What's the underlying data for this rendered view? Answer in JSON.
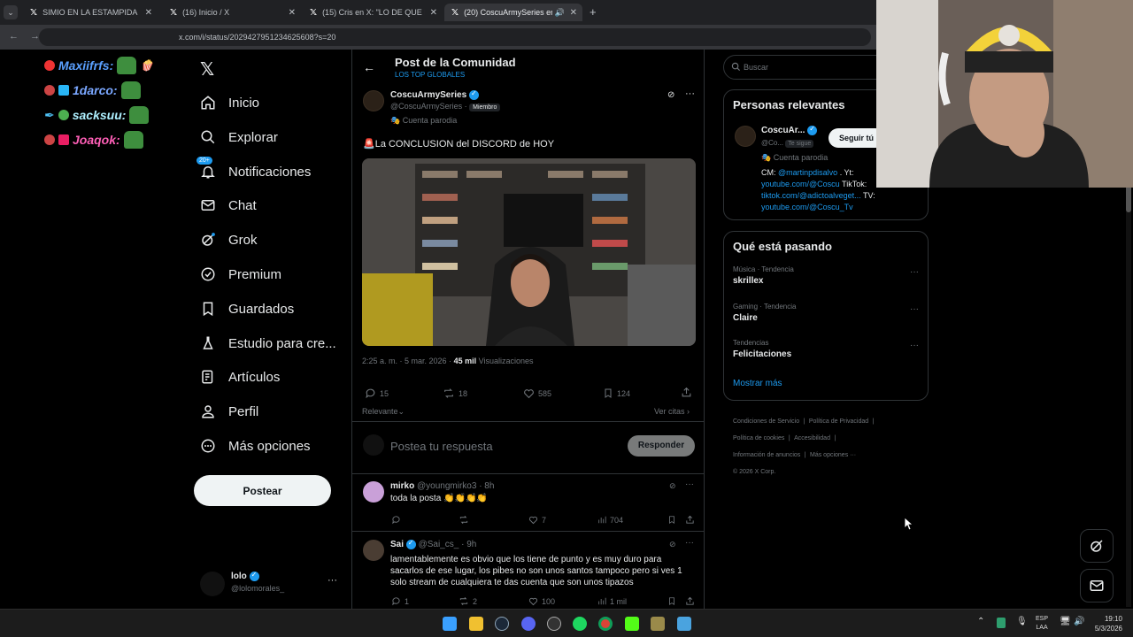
{
  "browser": {
    "tabs": [
      {
        "title": "SIMIO EN LA ESTAMPIDA"
      },
      {
        "title": "(16) Inicio / X"
      },
      {
        "title": "(15) Cris en X: \"LO DE QUE LOU"
      },
      {
        "title": "(20) CoscuArmySeries en X"
      }
    ],
    "new_tab": "+",
    "url": "x.com/i/status/2029427951234625608?s=20"
  },
  "overlay_chat": [
    {
      "user": "Maxiifrfs:",
      "color": "#5aa0ff"
    },
    {
      "user": "1darco:",
      "color": "#7aa7ff"
    },
    {
      "user": "sacksuu:",
      "color": "#aef0ff"
    },
    {
      "user": "Joaqok:",
      "color": "#ff5fb7"
    }
  ],
  "nav": {
    "items": [
      {
        "label": "Inicio"
      },
      {
        "label": "Explorar"
      },
      {
        "label": "Notificaciones",
        "badge": "20+"
      },
      {
        "label": "Chat"
      },
      {
        "label": "Grok"
      },
      {
        "label": "Premium"
      },
      {
        "label": "Guardados"
      },
      {
        "label": "Estudio para cre..."
      },
      {
        "label": "Artículos"
      },
      {
        "label": "Perfil"
      },
      {
        "label": "Más opciones"
      }
    ],
    "post_button": "Postear",
    "account": {
      "name": "lolo",
      "handle": "@lolomorales_",
      "more": "···"
    }
  },
  "main": {
    "header_title": "Post de la Comunidad",
    "header_subtitle": "LOS TOP GLOBALES",
    "post": {
      "author": "CoscuArmySeries",
      "handle": "@CoscuArmySeries",
      "member_badge": "Miembro",
      "parody_label": "Cuenta parodia",
      "text": "🚨La CONCLUSION del DISCORD de HOY",
      "time": "2:25 a. m. · 5 mar. 2026 ·",
      "views_count": "45 mil",
      "views_label": "Visualizaciones",
      "replies": "15",
      "reposts": "18",
      "likes": "585",
      "bookmarks": "124",
      "sort_label": "Relevante",
      "quotes_label": "Ver citas"
    },
    "reply_box": {
      "placeholder": "Postea tu respuesta",
      "button": "Responder"
    },
    "replies": [
      {
        "author": "mirko",
        "handle": "@youngmirko3 · 8h",
        "text": "toda la posta 👏👏👏👏",
        "replies": "",
        "reposts": "",
        "likes": "7",
        "views": "704"
      },
      {
        "author": "Sai",
        "handle": "@Sai_cs_ · 9h",
        "text": "lamentablemente es obvio que los tiene de punto y es muy duro para sacarlos de ese lugar, los pibes no son unos santos tampoco pero si ves 1 solo stream de cualquiera te das cuenta que son unos tipazos",
        "replies": "1",
        "reposts": "2",
        "likes": "100",
        "views": "1 mil"
      }
    ]
  },
  "right": {
    "search_placeholder": "Buscar",
    "relevant_title": "Personas relevantes",
    "person": {
      "name": "CoscuAr...",
      "handle": "@Co...",
      "follows_you": "Te sigue",
      "follow_button": "Seguir tú",
      "parody": "Cuenta parodia",
      "bio_cm": "CM:",
      "bio_cm_link": "@martinpdisalvo",
      "bio_yt": ". Yt:",
      "bio_link1": "youtube.com/@Coscu",
      "bio_tiktok": "TikTok:",
      "bio_link2": "tiktok.com/@adictoalveget...",
      "bio_tv": "TV:",
      "bio_link3": "youtube.com/@Coscu_Tv"
    },
    "trending_title": "Qué está pasando",
    "trends": [
      {
        "context": "Música · Tendencia",
        "name": "skrillex"
      },
      {
        "context": "Gaming · Tendencia",
        "name": "Claire"
      },
      {
        "context": "Tendencias",
        "name": "Felicitaciones"
      }
    ],
    "show_more": "Mostrar más",
    "footer": [
      "Condiciones de Servicio",
      "|",
      "Política de Privacidad",
      "|",
      "Política de cookies",
      "|",
      "Accesibilidad",
      "|",
      "Información de anuncios",
      "|",
      "Más opciones ···",
      "© 2026 X Corp."
    ]
  },
  "taskbar": {
    "lang1": "ESP",
    "lang2": "LAA",
    "time": "19:10",
    "date": "5/3/2026"
  },
  "colors": {
    "accent": "#1d9bf0",
    "bg": "#000000",
    "border": "#2f3336",
    "muted": "#71767b"
  }
}
